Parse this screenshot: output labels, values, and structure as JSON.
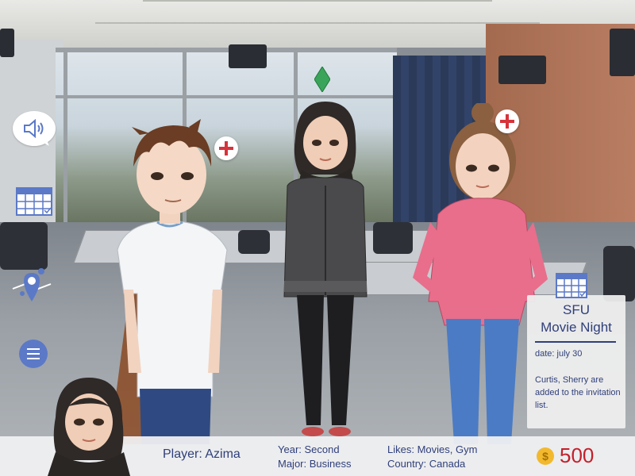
{
  "hud": {
    "sound_icon": "speaker-icon",
    "calendar_icon": "calendar-icon",
    "map_icon": "map-pin-icon",
    "menu_icon": "hamburger-menu-icon"
  },
  "characters": [
    {
      "id": "boy",
      "action_icon": "plus-icon"
    },
    {
      "id": "azima",
      "marker_icon": "green-diamond-icon"
    },
    {
      "id": "girl",
      "action_icon": "plus-icon"
    }
  ],
  "event": {
    "title_line1": "SFU",
    "title_line2": "Movie Night",
    "date": "date: july 30",
    "note": "Curtis, Sherry are added to the invitation list."
  },
  "player": {
    "label": "Player: Azima",
    "year": "Year: Second",
    "major": "Major: Business",
    "likes": "Likes: Movies, Gym",
    "country": "Country: Canada",
    "coin_symbol": "$",
    "coins": "500"
  },
  "colors": {
    "text_navy": "#2f3f7a",
    "coin_red": "#c4202b",
    "plus_red": "#d6333b",
    "diamond_green": "#3aa55a"
  }
}
